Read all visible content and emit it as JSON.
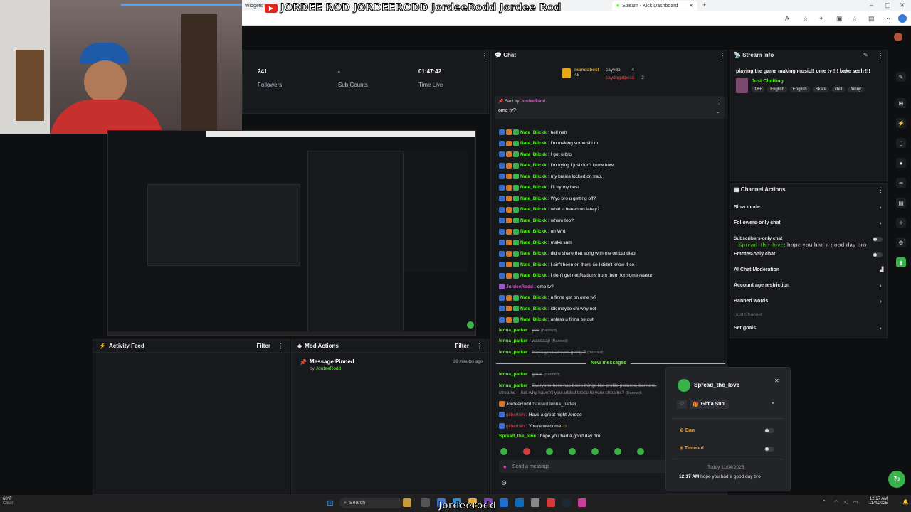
{
  "browser": {
    "tabs": [
      "Widgets f",
      "Stream - Kick Dashboard"
    ],
    "overlay_banner": "JORDEE ROD  JORDEERODD  JordeeRodd  Jordee Rod"
  },
  "stats": {
    "followers_value": "241",
    "followers_label": "Followers",
    "subs_value": "-",
    "subs_label": "Sub Counts",
    "time_value": "01:47:42",
    "time_label": "Time Live"
  },
  "activity_feed": {
    "title": "Activity Feed",
    "filter": "Filter"
  },
  "mod_actions": {
    "title": "Mod Actions",
    "filter": "Filter",
    "item_title": "Message Pinned",
    "item_by": "by",
    "item_user": "JordeeRodd",
    "item_time": "28 minutes ago"
  },
  "chat": {
    "title": "Chat",
    "top_gifters": [
      {
        "name": "maridabest",
        "count": "45"
      },
      {
        "name": "cayydo",
        "count": "4"
      },
      {
        "name": "caydogetpeso",
        "count": "2"
      }
    ],
    "pinned": {
      "sent_by": "Sent by",
      "user": "JordeeRodd",
      "message": "ome tv?"
    },
    "messages": [
      {
        "user": "Nate_Blickk",
        "text": "hell nah"
      },
      {
        "user": "Nate_Blickk",
        "text": "I'm making some shi rn"
      },
      {
        "user": "Nate_Blickk",
        "text": "I got u bro"
      },
      {
        "user": "Nate_Blickk",
        "text": "I'm trying I just don't know how"
      },
      {
        "user": "Nate_Blickk",
        "text": "my brains locked on trap."
      },
      {
        "user": "Nate_Blickk",
        "text": "I'll try my best"
      },
      {
        "user": "Nate_Blickk",
        "text": "Wyo bro u getting off?"
      },
      {
        "user": "Nate_Blickk",
        "text": "what u beeen on lately?"
      },
      {
        "user": "Nate_Blickk",
        "text": "where too?"
      },
      {
        "user": "Nate_Blickk",
        "text": "oh Wrd"
      },
      {
        "user": "Nate_Blickk",
        "text": "make sum"
      },
      {
        "user": "Nate_Blickk",
        "text": "did u share that song with me on bandlab"
      },
      {
        "user": "Nate_Blickk",
        "text": "I ain't been on there so I didn't know if so"
      },
      {
        "user": "Nate_Blickk",
        "text": "I don't get notifications from them for some reason"
      },
      {
        "user": "JordeeRodd",
        "text": "ome tv?"
      },
      {
        "user": "Nate_Blickk",
        "text": "u finna get on ome tv?"
      },
      {
        "user": "Nate_Blickk",
        "text": "idk maybe shi why not"
      },
      {
        "user": "Nate_Blickk",
        "text": "unless u finna be out"
      }
    ],
    "banned_messages": [
      {
        "user": "lenna_parker",
        "text": "yoo",
        "tag": "(Banned)"
      },
      {
        "user": "lenna_parker",
        "text": "wassaap",
        "tag": "(Banned)"
      },
      {
        "user": "lenna_parker",
        "text": "how's your stream going ?",
        "tag": "(Banned)"
      }
    ],
    "new_messages": "New messages",
    "after_messages": {
      "m1_user": "lenna_parker",
      "m1_text": "great",
      "m1_tag": "(Banned)",
      "m2_user": "lenna_parker",
      "m2_text": "Everyone here has basic things like profile pictures, banners,",
      "m2_text2": "streams -- but why haven't you added those to your streams?",
      "m2_tag": "(Banned)",
      "ban_user": "JordeeRodd",
      "ban_text": "banned",
      "ban_target": "lenna_parker",
      "g1_user": "gilbertsin",
      "g1_text": "Have a great night Jordee",
      "g2_user": "gilbertsin",
      "g2_text": "You're welcome",
      "s_user": "Spread_the_love",
      "s_text": "hope you had a good day bro"
    },
    "input_placeholder": "Send a message"
  },
  "stream_info": {
    "title": "Stream info",
    "stream_title": "playing the game making music!! ome tv !!! bake sesh !!!",
    "category": "Just Chatting",
    "tags": [
      "18+",
      "English",
      "English",
      "Skate",
      "chill",
      "funny"
    ]
  },
  "channel_actions": {
    "title": "Channel Actions",
    "items": [
      "Slow mode",
      "Followers-only chat",
      "Subscribers-only chat",
      "Emotes-only chat",
      "AI Chat Moderation",
      "Account age restriction",
      "Banned words",
      "Host Channel",
      "Set goals"
    ],
    "overlay_user": "Spread_the_love",
    "overlay_text": ": hope you had a good day bro"
  },
  "user_card": {
    "name": "Spread_the_love",
    "gift": "Gift a Sub",
    "ban": "Ban",
    "timeout": "Timeout",
    "date": "Today 11/04/2025",
    "time": "12:17 AM",
    "message": "hope you had a good day bro"
  },
  "taskbar": {
    "weather_temp": "60°F",
    "weather_desc": "Clear",
    "search": "Search",
    "overlay_name": "Jordeerodd",
    "time": "12:17 AM",
    "date": "11/4/2025"
  },
  "colors": {
    "kick_green": "#53fc18",
    "panel": "#18191c",
    "bg": "#0e0f11"
  }
}
